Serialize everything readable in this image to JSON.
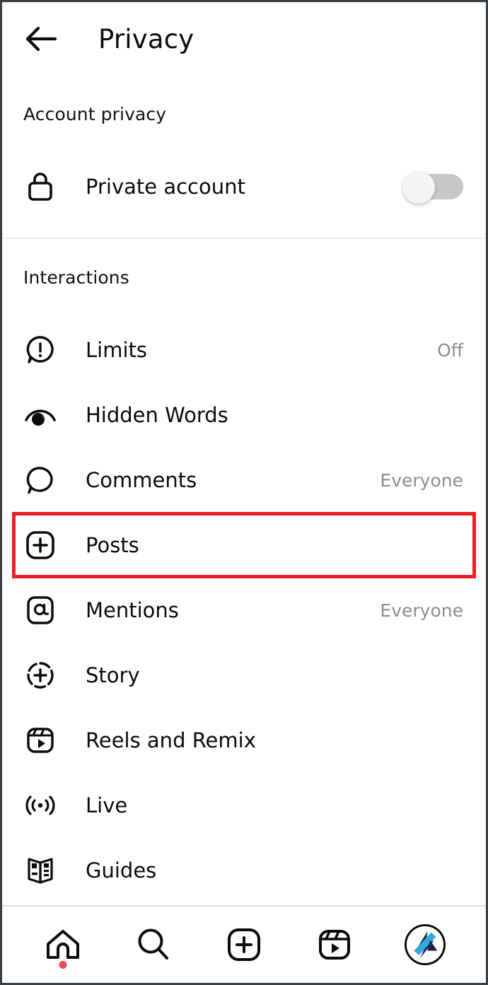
{
  "header": {
    "title": "Privacy",
    "back_icon": "arrow-left-icon"
  },
  "sections": [
    {
      "label": "Account privacy",
      "items": [
        {
          "label": "Private account",
          "icon": "lock-icon",
          "control": "toggle",
          "toggle_state": "off"
        }
      ]
    },
    {
      "label": "Interactions",
      "items": [
        {
          "label": "Limits",
          "icon": "limits-bubble-icon",
          "value": "Off"
        },
        {
          "label": "Hidden Words",
          "icon": "eye-icon",
          "value": ""
        },
        {
          "label": "Comments",
          "icon": "comment-bubble-icon",
          "value": "Everyone"
        },
        {
          "label": "Posts",
          "icon": "plus-square-icon",
          "value": "",
          "highlighted": true
        },
        {
          "label": "Mentions",
          "icon": "at-sign-icon",
          "value": "Everyone"
        },
        {
          "label": "Story",
          "icon": "story-plus-icon",
          "value": ""
        },
        {
          "label": "Reels and Remix",
          "icon": "reels-icon",
          "value": ""
        },
        {
          "label": "Live",
          "icon": "live-broadcast-icon",
          "value": ""
        },
        {
          "label": "Guides",
          "icon": "guides-book-icon",
          "value": ""
        }
      ]
    }
  ],
  "bottom_nav": [
    {
      "name": "home",
      "icon": "home-icon",
      "badge": true
    },
    {
      "name": "search",
      "icon": "search-icon",
      "badge": false
    },
    {
      "name": "create",
      "icon": "plus-square-icon",
      "badge": false
    },
    {
      "name": "reels",
      "icon": "reels-icon",
      "badge": false
    },
    {
      "name": "profile",
      "icon": "avatar-icon",
      "badge": false
    }
  ],
  "colors": {
    "highlight": "#ee1c25",
    "text_primary": "#0b0b0b",
    "text_secondary": "#8e8e8e",
    "badge": "#ed4956",
    "toggle_track_off": "#c7c7c7",
    "avatar_dark": "#1b2a4a",
    "avatar_blue": "#32a8e0"
  }
}
